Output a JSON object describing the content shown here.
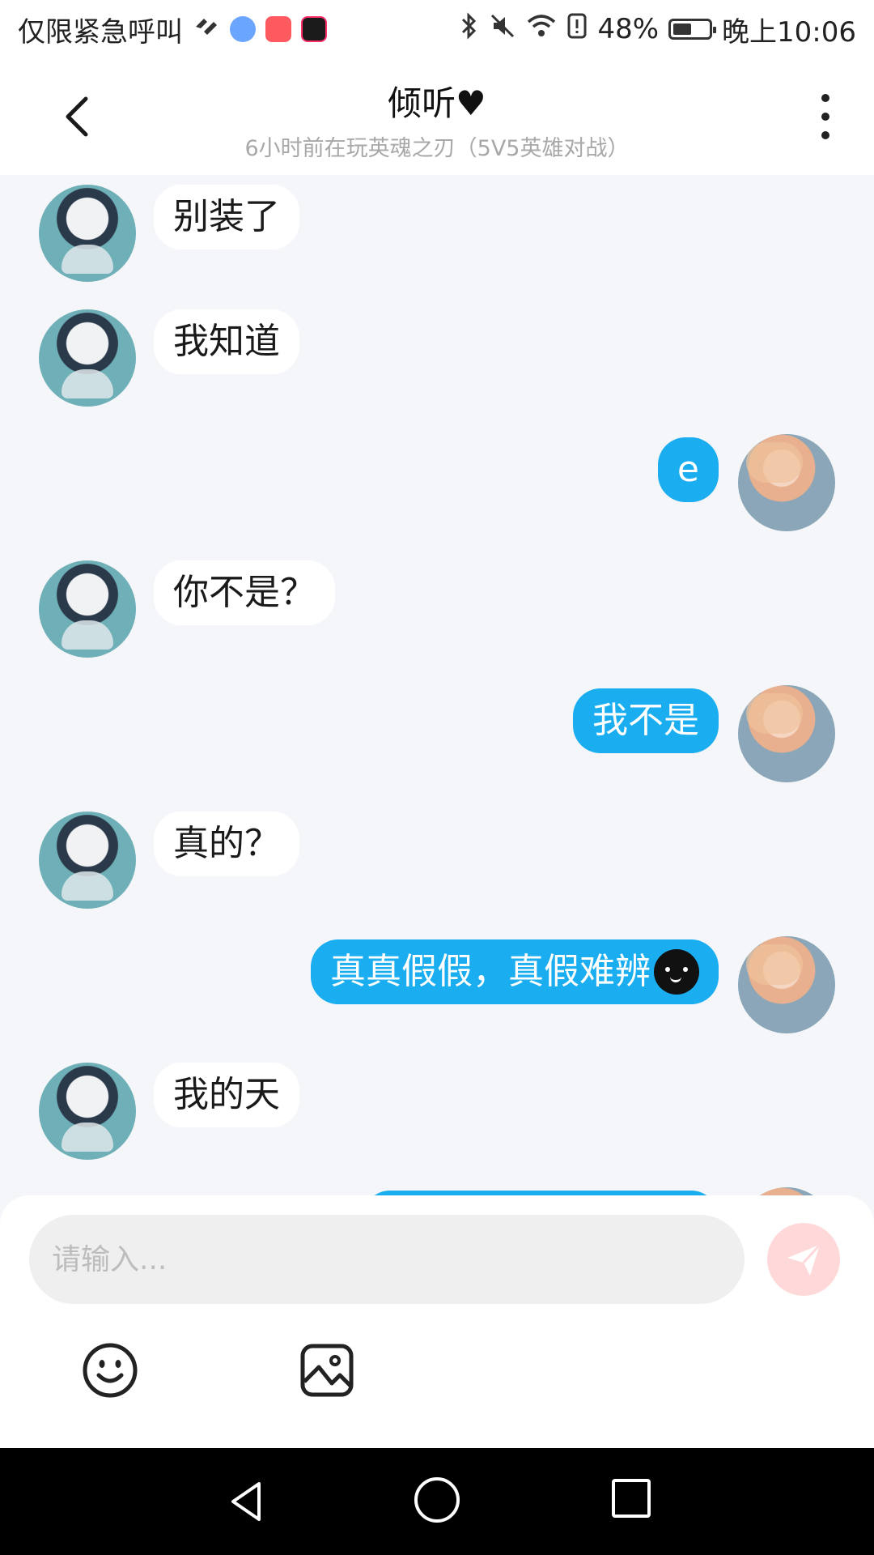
{
  "status_bar": {
    "carrier_text": "仅限紧急呼叫",
    "battery": "48%",
    "time": "晚上10:06",
    "icons": [
      "heart-pair-icon",
      "music-app-icon",
      "kuaishou-app-icon",
      "douyin-app-icon",
      "bluetooth-icon",
      "mute-icon",
      "wifi-icon",
      "alert-icon",
      "battery-icon"
    ]
  },
  "header": {
    "title": "倾听♥",
    "subtitle": "6小时前在玩英魂之刃（5V5英雄对战）"
  },
  "messages": [
    {
      "side": "left",
      "text": "别装了"
    },
    {
      "side": "left",
      "text": "我知道"
    },
    {
      "side": "right",
      "text": "e"
    },
    {
      "side": "left",
      "text": "你不是？"
    },
    {
      "side": "right",
      "text": "我不是"
    },
    {
      "side": "left",
      "text": "真的？"
    },
    {
      "side": "right",
      "text": "真真假假，真假难辨",
      "emoji": "smirk-face"
    },
    {
      "side": "left",
      "text": "我的天"
    }
  ],
  "input": {
    "placeholder": "请输入..."
  },
  "colors": {
    "accent_bubble": "#1aaef0",
    "incoming_bubble": "#ffffff",
    "chat_background": "#f4f6f9",
    "send_button": "#ffd9d9"
  }
}
